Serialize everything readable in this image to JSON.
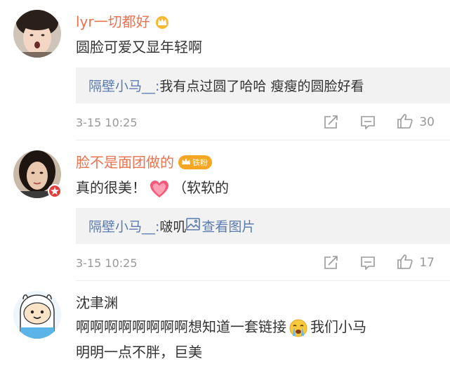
{
  "comments": [
    {
      "user": "lyr一切都好",
      "text": "圆脸可爱又显年轻啊",
      "reply_user": "隔壁小马__:",
      "reply_text": " 我有点过圆了哈哈 瘦瘦的圆脸好看",
      "time": "3-15 10:25",
      "likes": "30"
    },
    {
      "user": "脸不是面团做的",
      "badge": "铁粉",
      "text_before": "真的很美！",
      "text_after": "（软软的",
      "reply_user": "隔壁小马__:",
      "reply_text": " 啵叽 ",
      "view_image": "查看图片",
      "time": "3-15 10:25",
      "likes": "17"
    },
    {
      "user": "沈聿渊",
      "text_line1_before": "啊啊啊啊啊啊啊啊想知道一套链接",
      "text_line1_after": "我们小马",
      "text_line2": "明明一点不胖，巨美"
    }
  ],
  "colors": {
    "vip_name": "#eb7350",
    "link": "#5b7bb0",
    "muted": "#999999"
  },
  "icons": [
    "crown-icon",
    "share-icon",
    "reply-icon",
    "like-icon",
    "heart-emoji",
    "crying-emoji",
    "image-icon"
  ]
}
